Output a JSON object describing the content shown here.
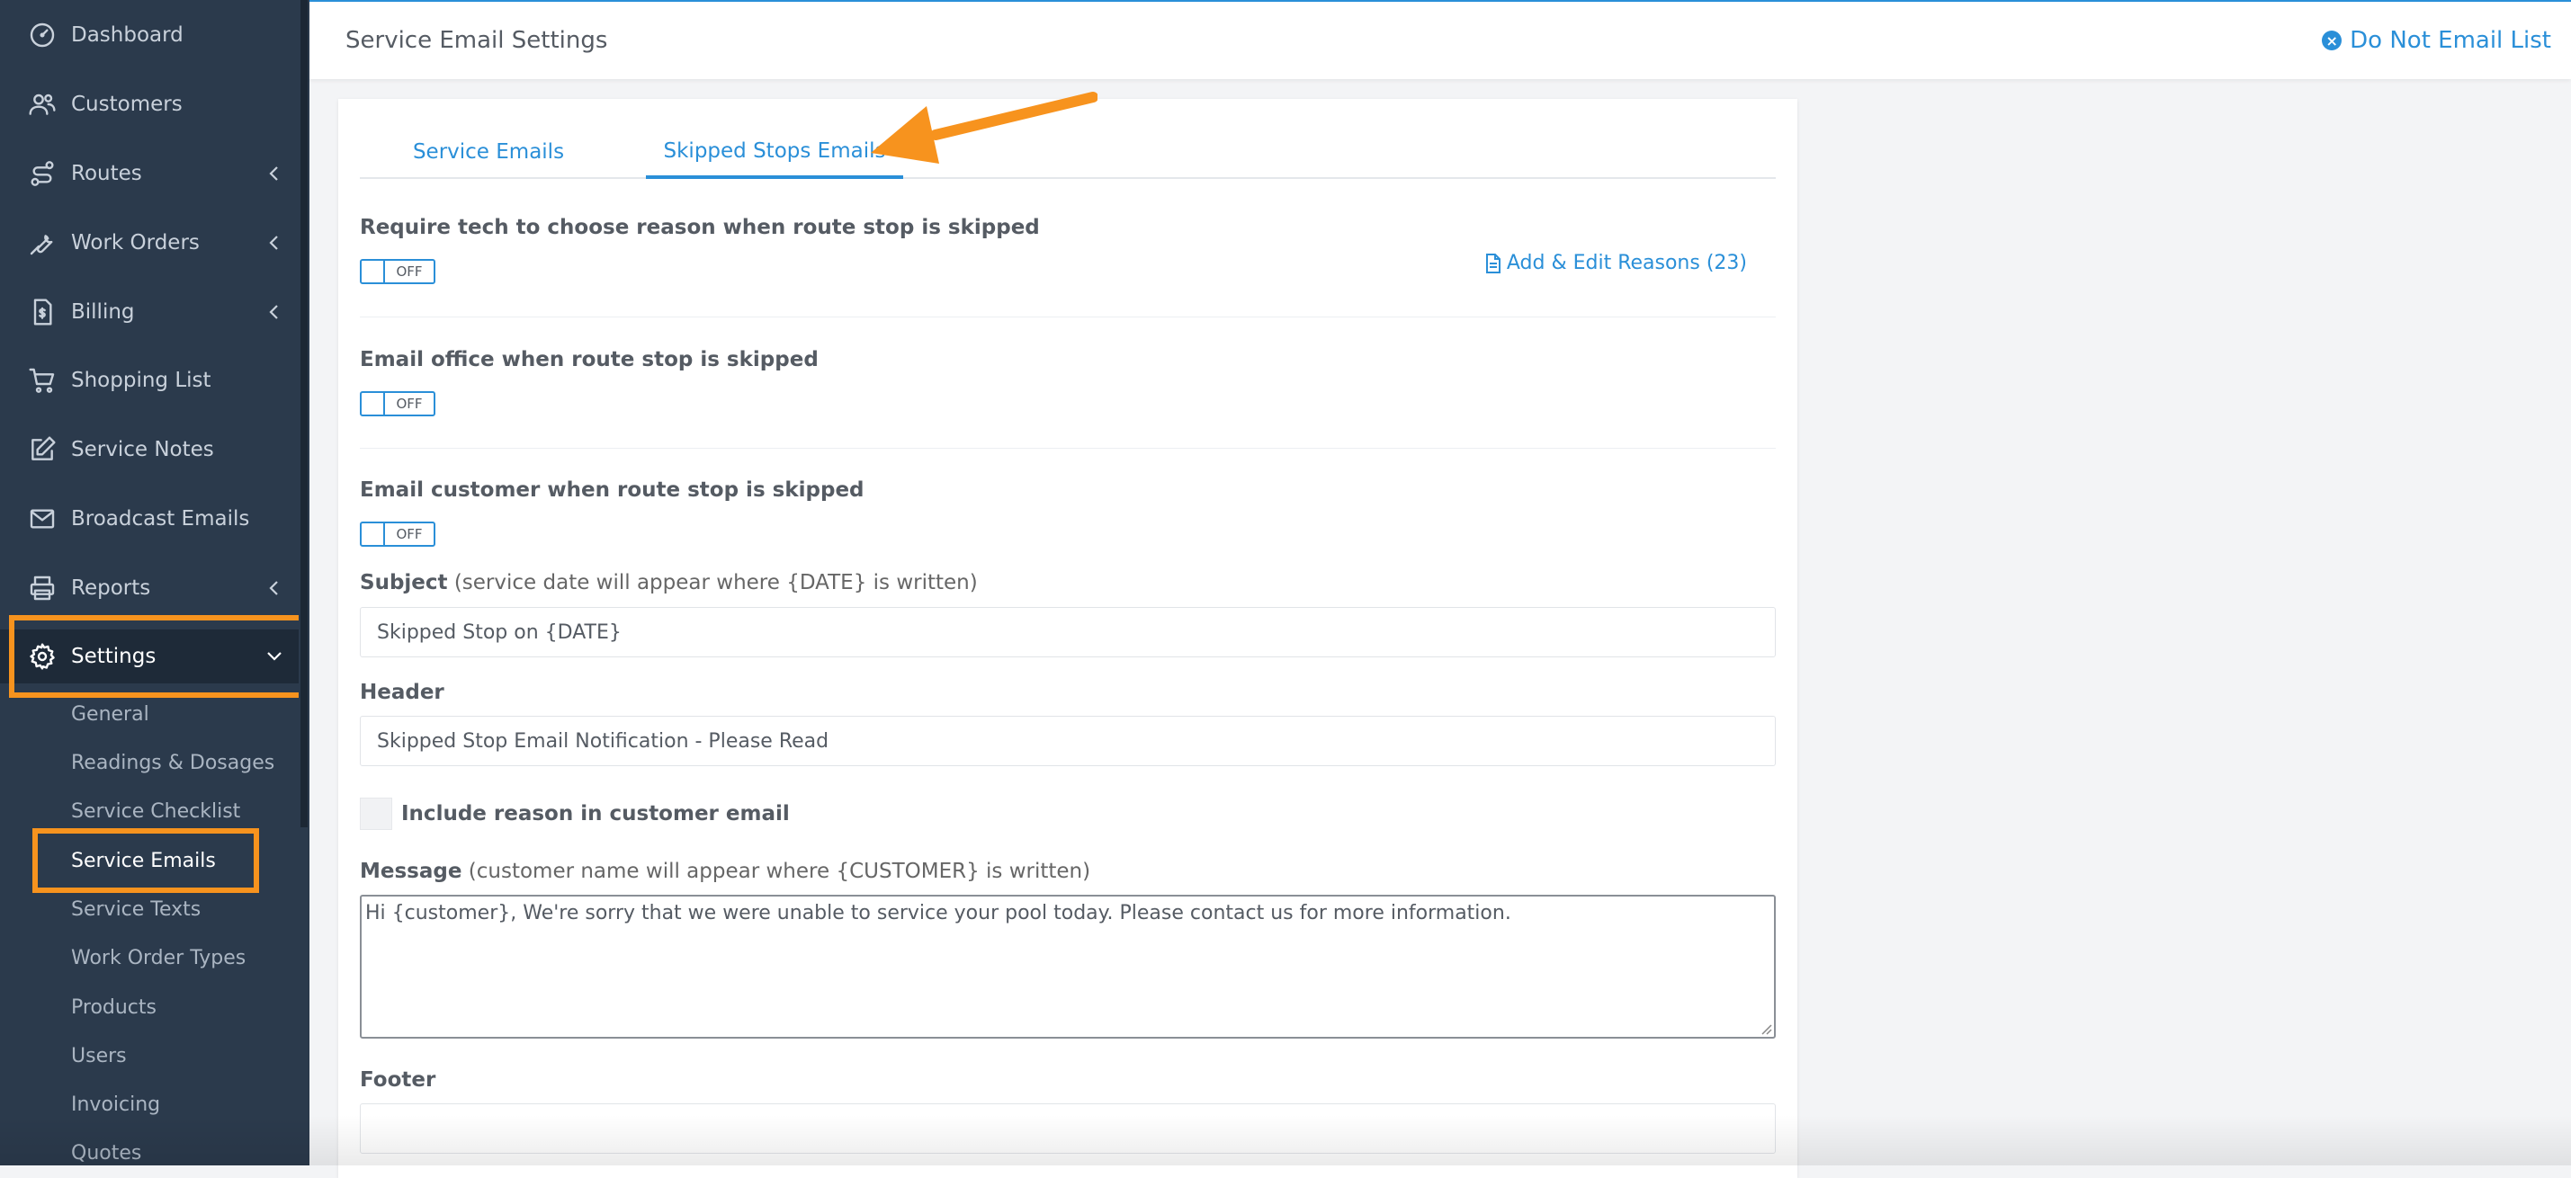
{
  "sidebar": {
    "items": [
      {
        "label": "Dashboard",
        "icon": "dashboard-icon"
      },
      {
        "label": "Customers",
        "icon": "customers-icon"
      },
      {
        "label": "Routes",
        "icon": "routes-icon"
      },
      {
        "label": "Work Orders",
        "icon": "wrench-icon"
      },
      {
        "label": "Billing",
        "icon": "billing-icon"
      },
      {
        "label": "Shopping List",
        "icon": "cart-icon"
      },
      {
        "label": "Service Notes",
        "icon": "edit-icon"
      },
      {
        "label": "Broadcast Emails",
        "icon": "envelope-icon"
      },
      {
        "label": "Reports",
        "icon": "printer-icon"
      },
      {
        "label": "Settings",
        "icon": "gear-icon"
      }
    ],
    "submenu": [
      "General",
      "Readings & Dosages",
      "Service Checklist",
      "Service Emails",
      "Service Texts",
      "Work Order Types",
      "Products",
      "Users",
      "Invoicing",
      "Quotes"
    ]
  },
  "header": {
    "title": "Service Email Settings",
    "do_not_email_label": "Do Not Email List"
  },
  "tabs": [
    "Service Emails",
    "Skipped Stops Emails"
  ],
  "form": {
    "require_reason_label": "Require tech to choose reason when route stop is skipped",
    "require_reason_toggle": "OFF",
    "add_edit_reasons": "Add & Edit Reasons (23)",
    "email_office_label": "Email office when route stop is skipped",
    "email_office_toggle": "OFF",
    "email_customer_label": "Email customer when route stop is skipped",
    "email_customer_toggle": "OFF",
    "subject_label": "Subject",
    "subject_hint": " (service date will appear where {DATE} is written)",
    "subject_value": "Skipped Stop on {DATE}",
    "header_label": "Header",
    "header_value": "Skipped Stop Email Notification - Please Read",
    "include_reason_label": "Include reason in customer email",
    "message_label": "Message",
    "message_hint": " (customer name will appear where {CUSTOMER} is written)",
    "message_value": "Hi {customer}, We're sorry that we were unable to service your pool today. Please contact us for more information.",
    "footer_label": "Footer",
    "footer_value": ""
  },
  "colors": {
    "accent": "#2a8fd8",
    "highlight": "#f7931e",
    "sidebar_bg": "#2b3a4c"
  }
}
